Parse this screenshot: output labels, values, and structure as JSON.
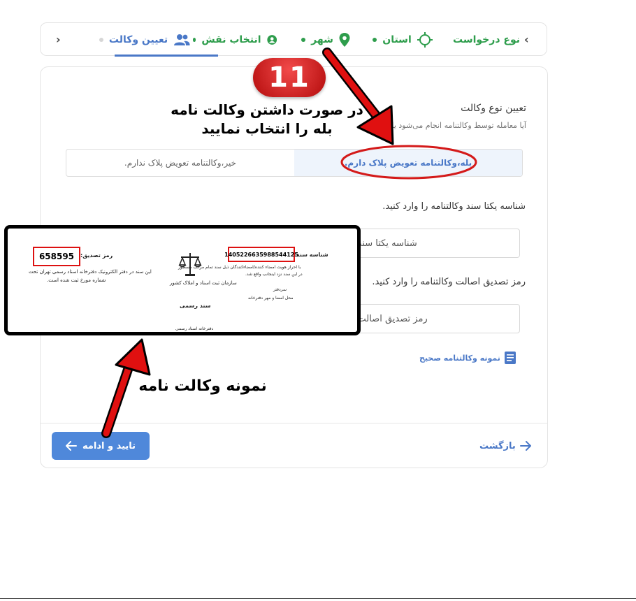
{
  "stepper": {
    "steps": [
      {
        "label": "تعیین وکالت",
        "state": "active",
        "icon": "people-icon"
      },
      {
        "label": "انتخاب نقش",
        "state": "done",
        "icon": "user-circle-icon"
      },
      {
        "label": "شهر",
        "state": "done",
        "icon": "map-pin-icon"
      },
      {
        "label": "استان",
        "state": "done",
        "icon": "crosshair-icon"
      },
      {
        "label": "نوع درخواست",
        "state": "done",
        "icon": ""
      }
    ],
    "prev_chevron": "‹",
    "next_chevron": "›"
  },
  "form": {
    "title": "تعیین نوع وکالت",
    "question": "آیا معامله توسط وکالتنامه انجام می‌شود یا",
    "options": {
      "yes": "بله،وکالتنامه تعویض پلاک دارم.",
      "no": "خیر،وکالتنامه تعویض پلاک ندارم."
    },
    "selected": "yes",
    "doc_id_label": "شناسه یکتا سند وکالتنامه را وارد کنید.",
    "doc_id_placeholder": "شناسه یکتا سند",
    "auth_code_label": "رمز تصدیق اصالت وکالتنامه را وارد کنید.",
    "auth_code_placeholder": "رمز تصدیق اصالت",
    "required_mark": "*",
    "sample_link": "نمونه وکالتنامه صحیح"
  },
  "footer": {
    "confirm_label": "تایید و ادامه",
    "back_label": "بازگشت"
  },
  "annotations": {
    "badge_number": "11",
    "hint_line1": "در صورت داشتن وکالت نامه",
    "hint_line2": "بله را انتخاب نمایید",
    "sample_caption": "نمونه وکالت نامه"
  },
  "sample_document": {
    "auth_code_label": "رمز تصدیق:",
    "auth_code_value": "658595",
    "doc_id_label": "شناسه سند:",
    "doc_id_value": "1405226635988544125",
    "text_right_1": "با احراز هویت امضاء کننده‌/امضاءکنندگان ذیل سند تمام مراتب مسطور",
    "text_right_2": "در این سند نزد اینجانب واقع شد.",
    "text_right_3": "سردفتر",
    "text_right_4": "محل امضا و مهر دفترخانه",
    "text_left_1": "این سند در دفتر الکترونیک دفترخانه اسناد رسمی      تهران تحت",
    "text_left_2": "شماره           مورخ           ثبت شده است.",
    "org_name": "سازمان ثبت اسناد و املاک کشور",
    "seal_title": "سند رسمی",
    "footer_text": "دفترخانه اسناد رسمی"
  }
}
